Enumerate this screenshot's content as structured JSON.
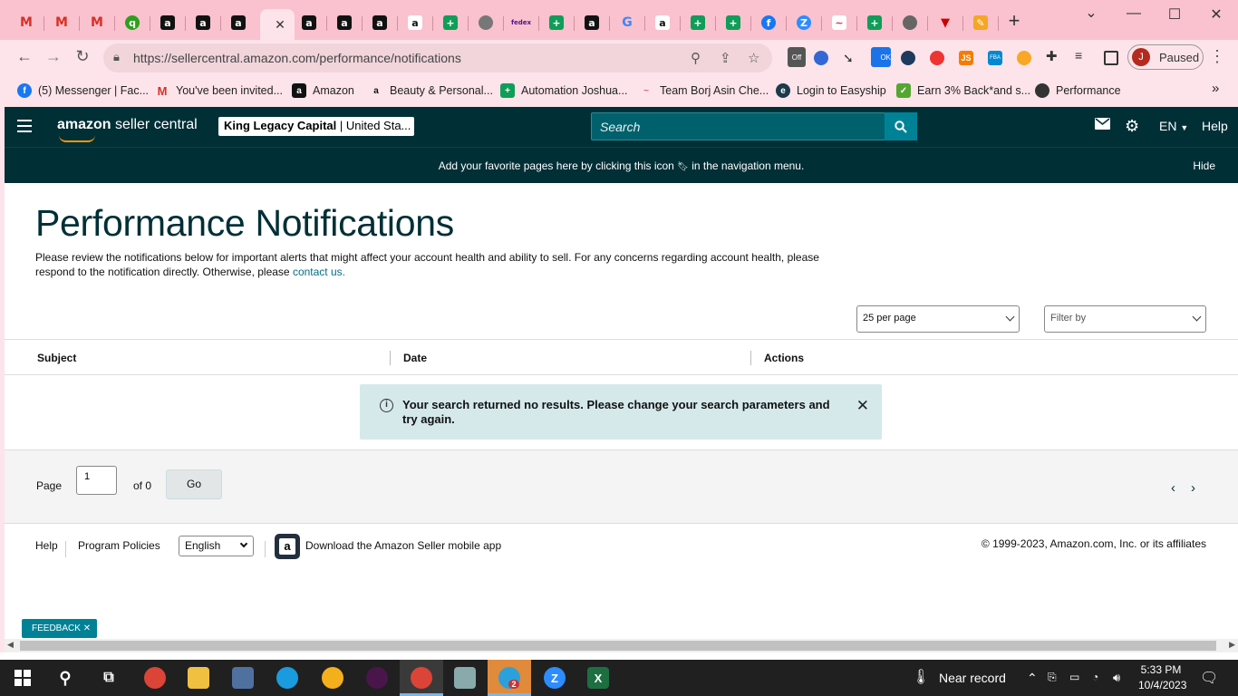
{
  "browser": {
    "address_url": "https://sellercentral.amazon.com/performance/notifications",
    "profile_initial": "J",
    "profile_status": "Paused",
    "new_tab_label": "+",
    "ext_badge_off": "Off",
    "ext_badge_ok": "OK",
    "ext_label_js": "JS",
    "ext_label_fba": "FBA",
    "bookmarks": [
      {
        "label": "(5) Messenger | Fac...",
        "icon": "facebook-icon",
        "color": "#1877f2"
      },
      {
        "label": "You've been invited...",
        "icon": "gmail-icon",
        "color": "#d93025"
      },
      {
        "label": "Amazon",
        "icon": "amazon-icon",
        "color": "#111111"
      },
      {
        "label": "Beauty & Personal...",
        "icon": "amazon-smile-icon",
        "color": "#ff9900"
      },
      {
        "label": "Automation Joshua...",
        "icon": "sheets-icon",
        "color": "#0f9d58"
      },
      {
        "label": "Team Borj Asin Che...",
        "icon": "signature-icon",
        "color": "#999999"
      },
      {
        "label": "Login to Easyship",
        "icon": "easyship-icon",
        "color": "#1b3a4b"
      },
      {
        "label": "Earn 3% Back*and s...",
        "icon": "topcashback-icon",
        "color": "#55a630"
      },
      {
        "label": "Performance",
        "icon": "globe-icon",
        "color": "#333333"
      }
    ],
    "more_bookmarks": "»"
  },
  "header": {
    "logo_text_bold": "amazon",
    "logo_text": " seller central",
    "account_name": "King Legacy Capital",
    "account_region": " | United Sta...",
    "search_placeholder": "Search",
    "language": "EN",
    "help": "Help"
  },
  "favorites_banner": {
    "message_part1": "Add your favorite pages here by clicking this icon",
    "message_part2": "in the navigation menu.",
    "hide": "Hide"
  },
  "page": {
    "title": "Performance Notifications",
    "intro": "Please review the notifications below for important alerts that might affect your account health and ability to sell. For any concerns regarding account health, please respond to the notification directly. Otherwise, please ",
    "intro_link": "contact us.",
    "per_page": "25 per page",
    "filter_placeholder": "Filter by",
    "columns": [
      "Subject",
      "Date",
      "Actions"
    ],
    "alert_message": "Your search returned no results. Please change your search parameters and try again.",
    "pager": {
      "page_label": "Page",
      "page_value": "1",
      "of_label": "of 0",
      "go": "Go"
    }
  },
  "footer": {
    "help": "Help",
    "program_policies": "Program Policies",
    "language": "English",
    "download_app": "Download the Amazon Seller mobile app",
    "copyright": "© 1999-2023, Amazon.com, Inc. or its affiliates"
  },
  "feedback": "FEEDBACK",
  "taskbar": {
    "weather": "Near record",
    "time": "5:33 PM",
    "date": "10/4/2023",
    "telegram_badge": "2"
  }
}
